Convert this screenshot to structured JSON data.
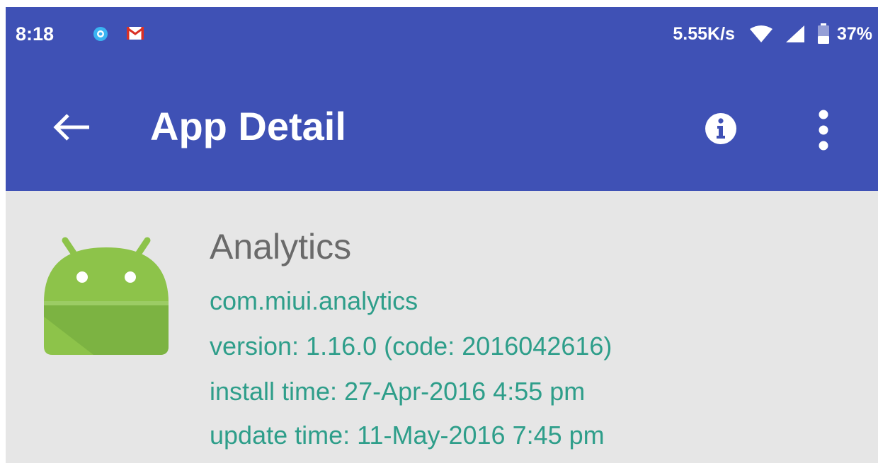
{
  "status_bar": {
    "time": "8:18",
    "notification_icons": [
      "browser-icon",
      "mail-icon"
    ],
    "network_speed": "5.55K/s",
    "battery_percent": "37%",
    "icons": [
      "wifi-icon",
      "signal-icon",
      "battery-icon"
    ]
  },
  "app_bar": {
    "title": "App Detail",
    "back_icon": "arrow-back-icon",
    "info_icon": "info-icon",
    "more_icon": "more-vert-icon",
    "background_color": "#3f51b5"
  },
  "app": {
    "name": "Analytics",
    "package": "com.miui.analytics",
    "version": "version: 1.16.0 (code: 2016042616)",
    "install_time": "install time: 27-Apr-2016 4:55 pm",
    "update_time": "update time: 11-May-2016 7:45 pm",
    "icon": "android-icon",
    "detail_color": "#2e9e8a"
  }
}
